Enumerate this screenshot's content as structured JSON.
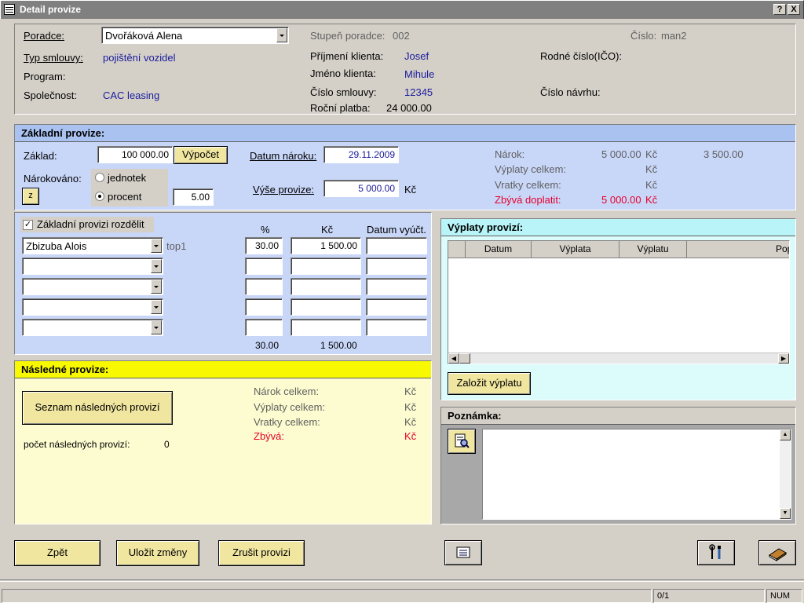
{
  "window": {
    "title": "Detail provize",
    "help": "?",
    "close": "X"
  },
  "header": {
    "poradce_label": "Poradce:",
    "poradce_value": "Dvořáková Alena",
    "typ_smlouvy_label": "Typ smlouvy:",
    "typ_smlouvy_value": "pojištění vozidel",
    "program_label": "Program:",
    "spolecnost_label": "Společnost:",
    "spolecnost_value": "CAC leasing",
    "stupen_label": "Stupeň poradce:",
    "stupen_value": "002",
    "cislo_label": "Číslo:",
    "cislo_value": "man2",
    "prijmeni_label": "Příjmení klienta:",
    "prijmeni_value": "Josef",
    "jmeno_label": "Jméno klienta:",
    "jmeno_value": "Mihule",
    "cislo_smlouvy_label": "Číslo smlouvy:",
    "cislo_smlouvy_value": "12345",
    "rocni_platba_label": "Roční platba:",
    "rocni_platba_value": "24 000.00",
    "rodne_cislo_label": "Rodné číslo(IČO):",
    "cislo_navrhu_label": "Číslo návrhu:"
  },
  "zakladni": {
    "title": "Základní provize:",
    "zaklad_label": "Základ:",
    "zaklad_value": "100 000.00",
    "vypocet_button": "Výpočet",
    "datum_naroku_label": "Datum nároku:",
    "datum_naroku_value": "29.11.2009",
    "narokovano_label": "Nárokováno:",
    "radio_jednotek": "jednotek",
    "radio_procent": "procent",
    "z_button": "z",
    "procent_value": "5.00",
    "vyse_label": "Výše provize:",
    "vyse_value": "5 000.00",
    "vyse_unit": "Kč",
    "narok_label": "Nárok:",
    "narok_value": "5 000.00",
    "narok_unit": "Kč",
    "narok_extra": "3 500.00",
    "vyplaty_label": "Výplaty celkem:",
    "vyplaty_unit": "Kč",
    "vratky_label": "Vratky celkem:",
    "vratky_unit": "Kč",
    "zbyva_label": "Zbývá doplatit:",
    "zbyva_value": "5 000.00",
    "zbyva_unit": "Kč"
  },
  "rozdeleni": {
    "checkbox_label": "Základní provizi rozdělit",
    "col_pct": "%",
    "col_kc": "Kč",
    "col_datum": "Datum vyúčt.",
    "row1_name": "Zbizuba Alois",
    "row1_tag": "top1",
    "row1_pct": "30.00",
    "row1_kc": "1 500.00",
    "total_pct": "30.00",
    "total_kc": "1 500.00"
  },
  "vyplaty": {
    "title": "Výplaty provizí:",
    "columns": [
      "Datum",
      "Výplata",
      "Výplatu",
      "Popi"
    ],
    "zalozit_button": "Založit výplatu"
  },
  "nasledne": {
    "title": "Následné provize:",
    "seznam_button": "Seznam následných provizí",
    "pocet_label": "počet následných provizí:",
    "pocet_value": "0",
    "narok_label": "Nárok celkem:",
    "vyplaty_label": "Výplaty celkem:",
    "vratky_label": "Vratky celkem:",
    "zbyva_label": "Zbývá:",
    "unit": "Kč"
  },
  "poznamka": {
    "title": "Poznámka:"
  },
  "footer": {
    "zpet": "Zpět",
    "ulozit": "Uložit změny",
    "zrusit": "Zrušit provizi"
  },
  "statusbar": {
    "pager": "0/1",
    "num": "NUM"
  },
  "colors": {
    "blue_header": "#a9c2f0",
    "blue_panel": "#c8d6f8",
    "cyan_header": "#b8f4f8",
    "cyan_panel": "#dcfbfb",
    "yellow_header": "#f8f800",
    "yellow_panel": "#fcfcd0",
    "button": "#f0e6a0",
    "red": "#e8002a"
  }
}
